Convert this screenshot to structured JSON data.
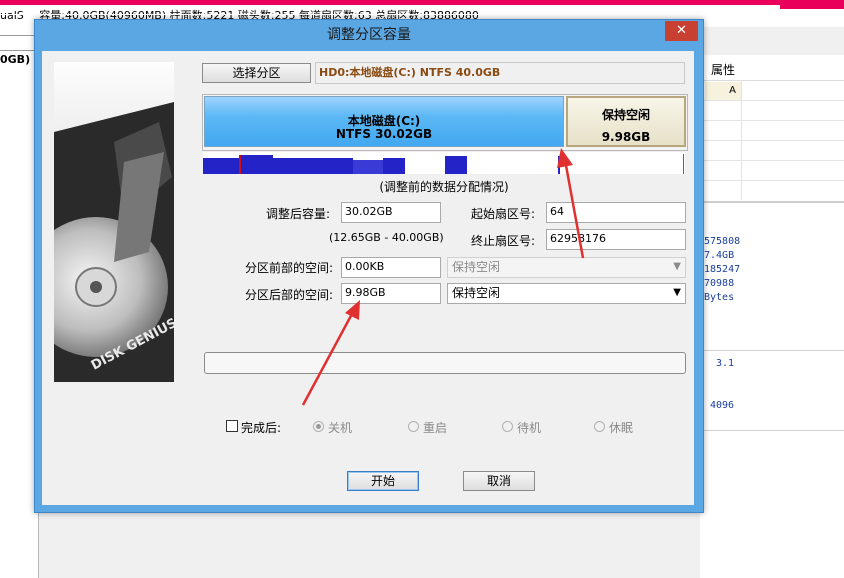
{
  "background_app": {
    "left_partial_text": "ualS",
    "status_text": "容量:40.0GB(40960MB)  柱面数:5221  磁头数:255  每道扇区数:63  总扇区数:83886080",
    "left_pane_text": "0GB)",
    "attr_header": "属性",
    "attr_value": "A",
    "right_numbers": [
      "575808",
      "7.4GB",
      "185247",
      "70988",
      "Bytes"
    ],
    "right_value_a": "3.1",
    "right_value_b": "4096"
  },
  "dialog": {
    "title": "调整分区容量",
    "close_symbol": "✕",
    "select_partition_button": "选择分区",
    "partition_path": "HD0:本地磁盘(C:) NTFS 40.0GB",
    "bar": {
      "used_name": "本地磁盘(C:)",
      "used_info": "NTFS 30.02GB",
      "free_name": "保持空闲",
      "free_size": "9.98GB",
      "used_fraction": 0.7505
    },
    "bar_caption": "(调整前的数据分配情况)",
    "resized_capacity_label": "调整后容量:",
    "resized_capacity_value": "30.02GB",
    "capacity_range": "(12.65GB - 40.00GB)",
    "start_sector_label": "起始扇区号:",
    "start_sector_value": "64",
    "end_sector_label": "终止扇区号:",
    "end_sector_value": "62958176",
    "front_space_label": "分区前部的空间:",
    "front_space_value": "0.00KB",
    "front_space_option": "保持空闲",
    "back_space_label": "分区后部的空间:",
    "back_space_value": "9.98GB",
    "back_space_option": "保持空闲",
    "progress_fraction": 0,
    "after_complete_label": "完成后:",
    "after_options": [
      "关机",
      "重启",
      "待机",
      "休眠"
    ],
    "start_button": "开始",
    "cancel_button": "取消",
    "accent_color": "#5aa7e4",
    "arrow_color": "#e03030"
  }
}
